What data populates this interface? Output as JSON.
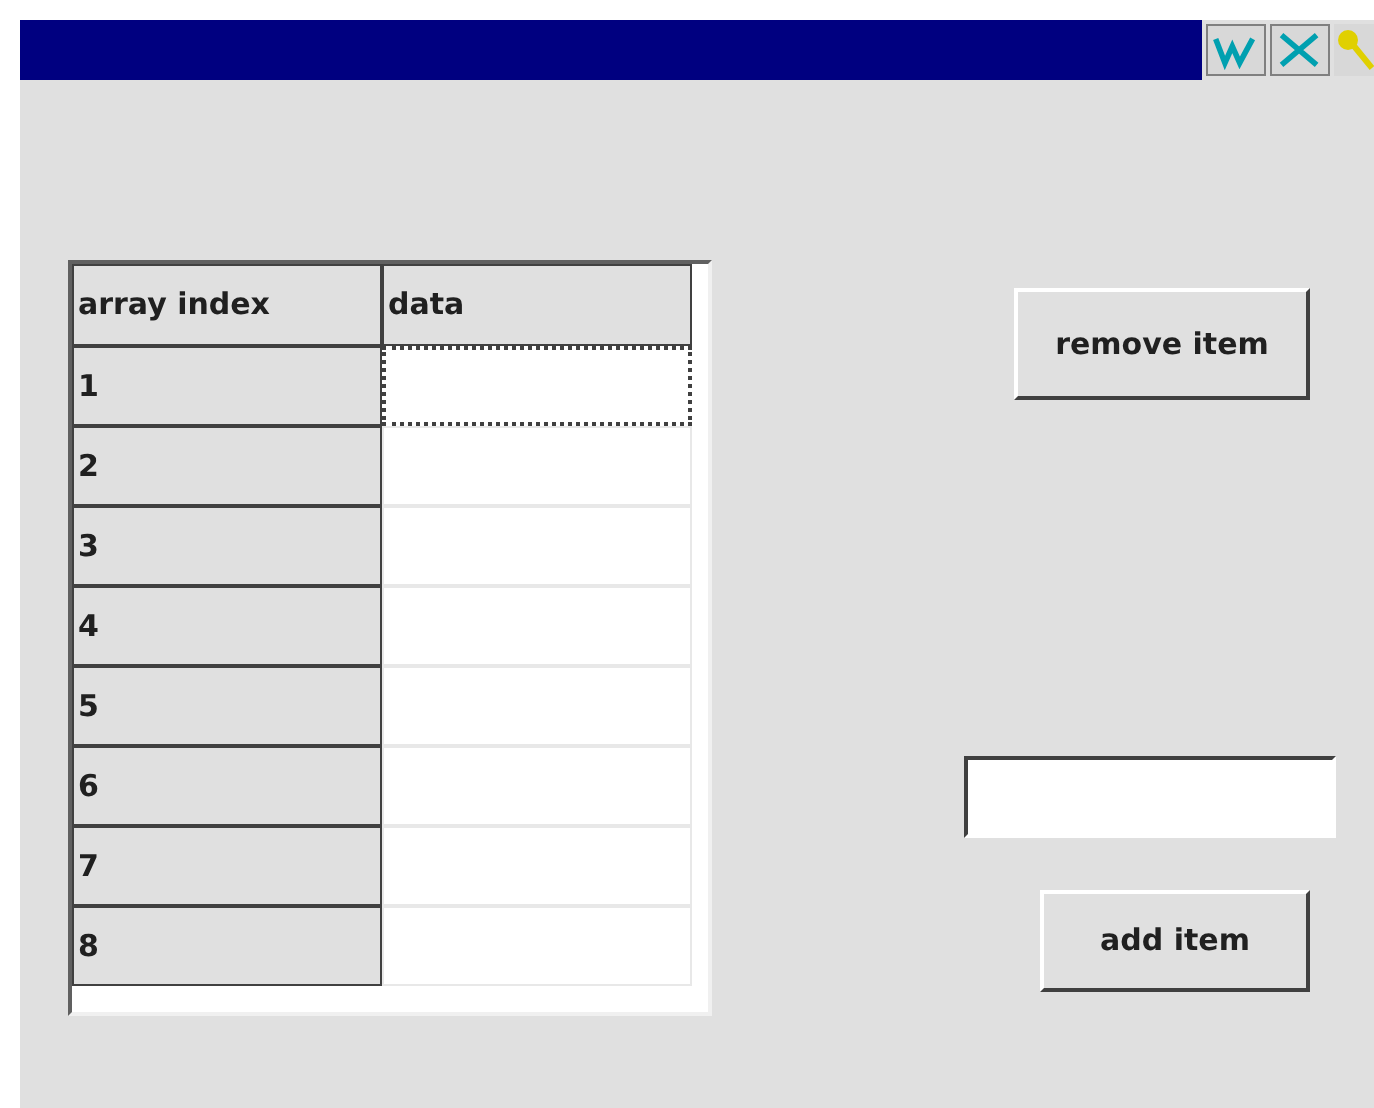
{
  "table": {
    "columns": [
      "array index",
      "data"
    ],
    "rows": [
      {
        "index": "1",
        "selected": true
      },
      {
        "index": "2",
        "selected": false
      },
      {
        "index": "3",
        "selected": false
      },
      {
        "index": "4",
        "selected": false
      },
      {
        "index": "5",
        "selected": false
      },
      {
        "index": "6",
        "selected": false
      },
      {
        "index": "7",
        "selected": false
      },
      {
        "index": "8",
        "selected": false
      }
    ]
  },
  "buttons": {
    "remove": "remove item",
    "add": "add item"
  }
}
